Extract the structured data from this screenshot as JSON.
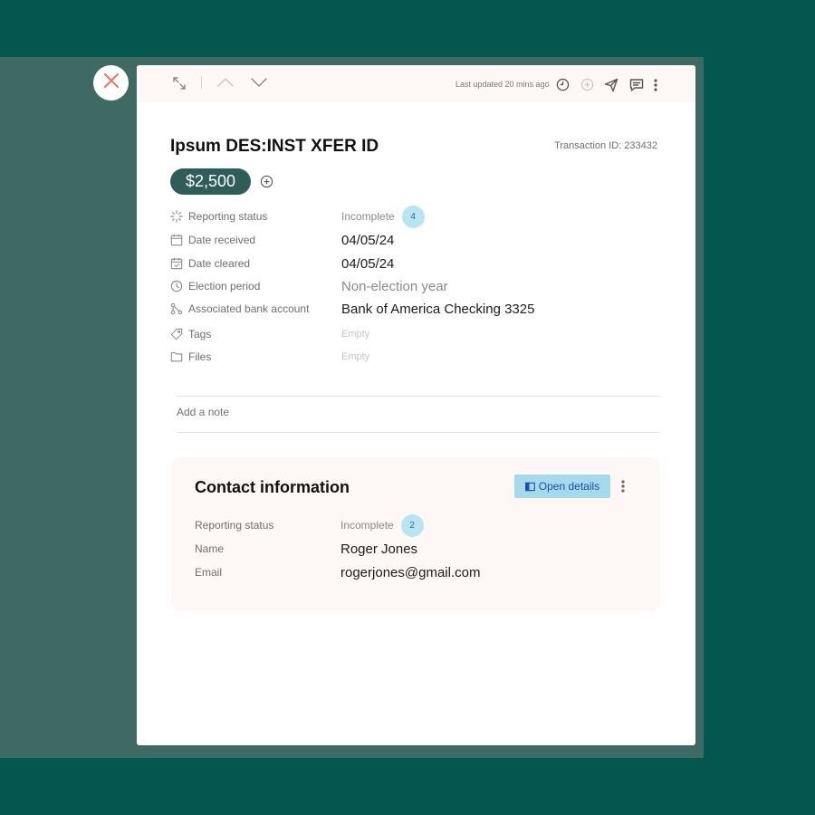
{
  "toolbar": {
    "last_updated": "Last updated 20 mins ago",
    "icons": [
      "expand-icon",
      "chevron-up-icon",
      "chevron-down-icon",
      "history-icon",
      "add-circle-icon",
      "send-icon",
      "comment-icon",
      "more-vertical-icon"
    ]
  },
  "close_icon": "close-icon",
  "transaction": {
    "title": "Ipsum DES:INST XFER ID",
    "id_text": "Transaction ID: 233432",
    "amount": "$2,500",
    "properties": [
      {
        "icon": "loading-icon",
        "label": "Reporting status",
        "value": "Incomplete",
        "badge": "4"
      },
      {
        "icon": "calendar-icon",
        "label": "Date received",
        "value": "04/05/24"
      },
      {
        "icon": "calendar-check-icon",
        "label": "Date cleared",
        "value": "04/05/24"
      },
      {
        "icon": "clock-icon",
        "label": "Election period",
        "value": "Non-election year"
      },
      {
        "icon": "branch-icon",
        "label": "Associated bank account",
        "value": "Bank of America Checking 3325"
      },
      {
        "icon": "tag-icon",
        "label": "Tags",
        "value": "Empty"
      },
      {
        "icon": "folder-icon",
        "label": "Files",
        "value": "Empty"
      }
    ],
    "note_placeholder": "Add a note"
  },
  "contact": {
    "title": "Contact information",
    "open_details_label": "Open details",
    "rows": [
      {
        "label": "Reporting status",
        "value": "Incomplete",
        "badge": "2"
      },
      {
        "label": "Name",
        "value": "Roger Jones"
      },
      {
        "label": "Email",
        "value": "rogerjones@gmail.com"
      }
    ]
  },
  "colors": {
    "background": "#03574f",
    "overlay": "#3f6a63",
    "amount_pill": "#2e5e57",
    "badge": "#b9e4f2",
    "open_details_button": "#a6d9ec",
    "close_icon": "#e8735f"
  }
}
